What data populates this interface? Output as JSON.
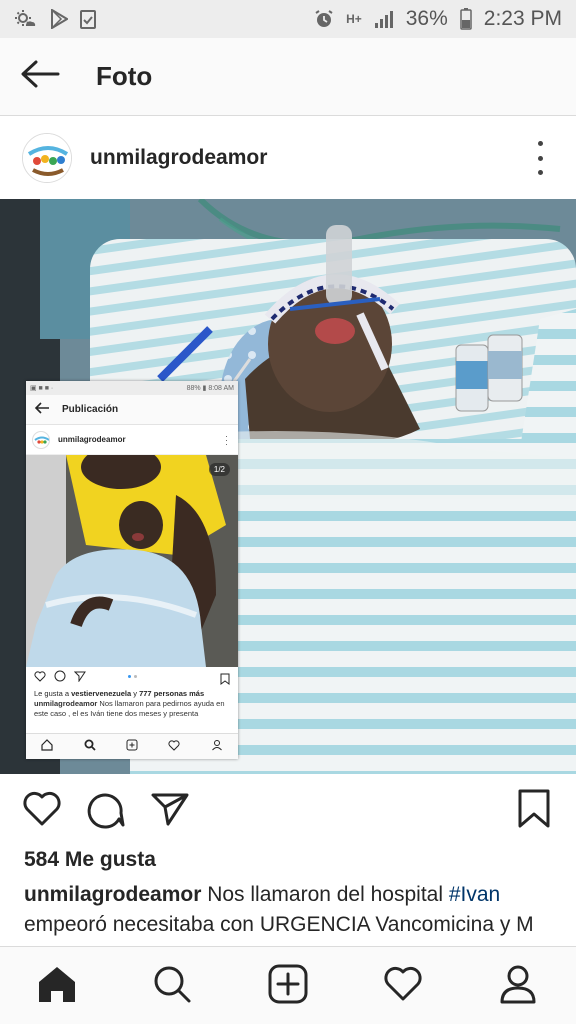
{
  "status_bar": {
    "battery_percent": "36%",
    "time": "2:23 PM",
    "network": "H+",
    "left_icons": [
      "weather-icon",
      "play-store-icon",
      "clipboard-check-icon"
    ],
    "right_icons": [
      "alarm-icon",
      "signal-icon",
      "battery-icon"
    ]
  },
  "app_bar": {
    "title": "Foto",
    "back_icon": "arrow-left-icon"
  },
  "post": {
    "username": "unmilagrodeamor",
    "more_icon": "more-vertical-icon",
    "likes": "584 Me gusta",
    "caption_user": "unmilagrodeamor",
    "caption_text_1": " Nos llamaron del hospital ",
    "caption_hashtag": "#Ivan",
    "caption_text_2": " empeoró necesitaba con URGENCIA Vancomicina y M",
    "action_icons": [
      "heart-icon",
      "comment-icon",
      "share-icon",
      "bookmark-icon"
    ]
  },
  "inner_screenshot": {
    "status_left": "▣ ■ ■ ·",
    "status_right": "88% ▮ 8:08 AM",
    "title": "Publicación",
    "username": "unmilagrodeamor",
    "pager": "1/2",
    "likes_prefix": "Le gusta a ",
    "likes_user": "vestiervenezuela",
    "likes_middle": " y ",
    "likes_count": "777 personas más",
    "caption_user": "unmilagrodeamor",
    "caption_text": " Nos llamaron para pedirnos ayuda en este caso , el es Iván tiene dos meses y presenta"
  },
  "bottom_nav": {
    "items": [
      "home-icon",
      "search-icon",
      "add-post-icon",
      "activity-heart-icon",
      "profile-icon"
    ]
  },
  "colors": {
    "text": "#262626",
    "hashtag": "#003569",
    "bar_bg": "#fafafa",
    "status_bg": "#ededed",
    "divider": "#dbdbdb"
  }
}
